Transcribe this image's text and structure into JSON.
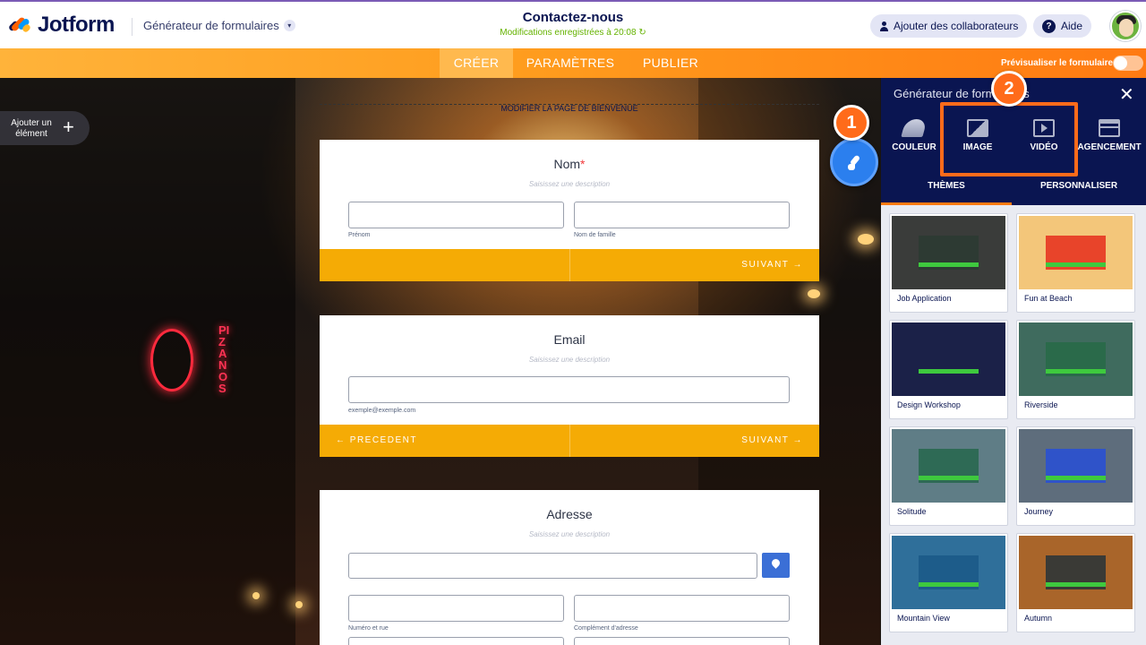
{
  "header": {
    "logo_text": "Jotform",
    "generator_label": "Générateur de formulaires",
    "form_title": "Contactez-nous",
    "saved_status": "Modifications enregistrées à 20:08",
    "collab_label": "Ajouter des collaborateurs",
    "help_label": "Aide"
  },
  "tabs": {
    "create": "CRÉER",
    "settings": "PARAMÈTRES",
    "publish": "PUBLIER",
    "preview_label": "Prévisualiser le formulaire"
  },
  "canvas": {
    "add_element": "Ajouter un élément",
    "edit_welcome": "MODIFIER LA PAGE DE BIENVENUE",
    "neon_sign": "PIZANOS"
  },
  "form": {
    "name": {
      "label": "Nom",
      "required_mark": "*",
      "description": "Saisissez une description",
      "first_sublabel": "Prénom",
      "last_sublabel": "Nom de famille",
      "next": "SUIVANT →"
    },
    "email": {
      "label": "Email",
      "description": "Saisissez une description",
      "sublabel": "exemple@exemple.com",
      "prev": "← PRECEDENT",
      "next": "SUIVANT →"
    },
    "address": {
      "label": "Adresse",
      "description": "Saisissez une description",
      "street_sublabel": "Numéro et rue",
      "complement_sublabel": "Complément d'adresse"
    }
  },
  "badges": {
    "one": "1",
    "two": "2"
  },
  "panel": {
    "title": "Générateur de formulaires",
    "tabs": [
      "COULEUR",
      "IMAGE",
      "VIDÉO",
      "AGENCEMENT"
    ],
    "subtabs": {
      "themes": "THÈMES",
      "customize": "PERSONNALISER"
    },
    "themes": [
      {
        "name": "Job Application",
        "bg": "#3a3c3a",
        "box": "#2d3a33"
      },
      {
        "name": "Fun at Beach",
        "bg": "#f3c67a",
        "box": "#e8442a"
      },
      {
        "name": "Design Workshop",
        "bg": "#1b2148",
        "box": "#1b2148"
      },
      {
        "name": "Riverside",
        "bg": "#3f6b5e",
        "box": "#2a6a4a"
      },
      {
        "name": "Solitude",
        "bg": "#5f7d86",
        "box": "#2e6a55"
      },
      {
        "name": "Journey",
        "bg": "#5e6d7c",
        "box": "#2f53c9"
      },
      {
        "name": "Mountain View",
        "bg": "#2f6f9a",
        "box": "#1d5c8a"
      },
      {
        "name": "Autumn",
        "bg": "#a9652a",
        "box": "#3a3a36"
      }
    ]
  },
  "colors": {
    "brand_navy": "#0a1551",
    "orange": "#ff7a12",
    "nav_gold": "#f5ab05",
    "saved_green": "#64b200"
  }
}
